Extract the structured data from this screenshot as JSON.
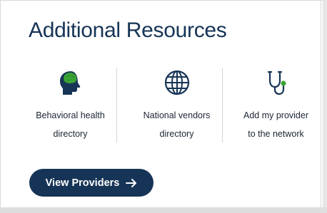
{
  "card": {
    "title": "Additional Resources"
  },
  "resources": [
    {
      "icon": "head-brain-icon",
      "line1": "Behavioral health",
      "line2": "directory"
    },
    {
      "icon": "globe-icon",
      "line1": "National vendors",
      "line2": "directory"
    },
    {
      "icon": "stethoscope-icon",
      "line1": "Add my provider",
      "line2": "to the network"
    }
  ],
  "button": {
    "label": "View Providers",
    "icon": "arrow-right-icon"
  },
  "colors": {
    "brand_navy": "#163456",
    "accent_green": "#3aa335",
    "text_dark": "#1b2533"
  }
}
